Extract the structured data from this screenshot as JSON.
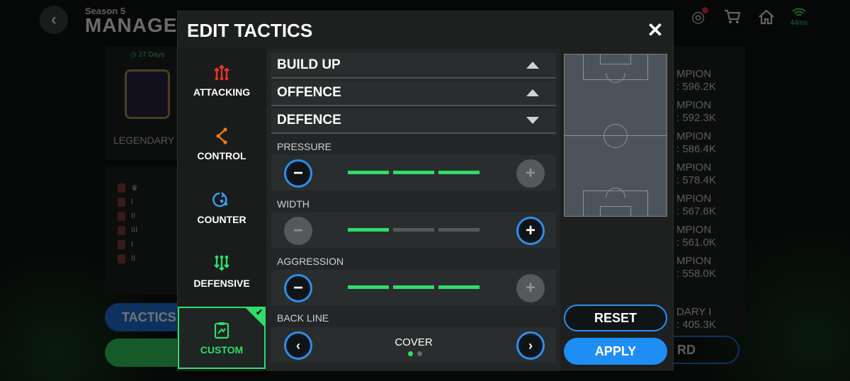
{
  "background": {
    "season_label": "Season 5",
    "title": "MANAGE",
    "timer": "27 Days",
    "tier_label": "LEGENDARY",
    "ping": "44ms",
    "rank_rows": [
      "",
      "I",
      "II",
      "III",
      "I",
      "II"
    ],
    "tactics_label": "TACTICS",
    "right_list": [
      {
        "name": "MPION",
        "score": ": 596.2K"
      },
      {
        "name": "MPION",
        "score": ": 592.3K"
      },
      {
        "name": "MPION",
        "score": ": 586.4K"
      },
      {
        "name": "MPION",
        "score": ": 578.4K"
      },
      {
        "name": "MPION",
        "score": ": 567.6K"
      },
      {
        "name": "MPION",
        "score": ": 561.0K"
      },
      {
        "name": "MPION",
        "score": ": 558.0K"
      }
    ],
    "legend_item": {
      "name": "DARY I",
      "score": ": 405.3K"
    },
    "rd_label": "RD"
  },
  "modal": {
    "title": "EDIT TACTICS",
    "close_icon": "close-icon",
    "sidebar": [
      {
        "label": "ATTACKING",
        "icon": "attacking-icon",
        "color": "#e8352b"
      },
      {
        "label": "CONTROL",
        "icon": "control-icon",
        "color": "#f07a1d"
      },
      {
        "label": "COUNTER",
        "icon": "counter-icon",
        "color": "#3aa2f0"
      },
      {
        "label": "DEFENSIVE",
        "icon": "defensive-icon",
        "color": "#2fdc6b"
      },
      {
        "label": "CUSTOM",
        "icon": "custom-clipboard-icon",
        "color": "#2fdc6b",
        "active": true
      }
    ],
    "sections": [
      {
        "label": "BUILD UP",
        "state": "collapsed"
      },
      {
        "label": "OFFENCE",
        "state": "collapsed"
      },
      {
        "label": "DEFENCE",
        "state": "expanded"
      }
    ],
    "sliders": [
      {
        "label": "PRESSURE",
        "level": 3,
        "max": 3
      },
      {
        "label": "WIDTH",
        "level": 1,
        "max": 3
      },
      {
        "label": "AGGRESSION",
        "level": 3,
        "max": 3
      }
    ],
    "back_line": {
      "label": "BACK LINE",
      "value": "COVER",
      "page": 1,
      "pages": 2
    },
    "reset_label": "RESET",
    "apply_label": "APPLY"
  },
  "colors": {
    "accent_green": "#2fdc6b",
    "accent_blue": "#2b8ff0",
    "apply_blue": "#1e8ef4"
  }
}
